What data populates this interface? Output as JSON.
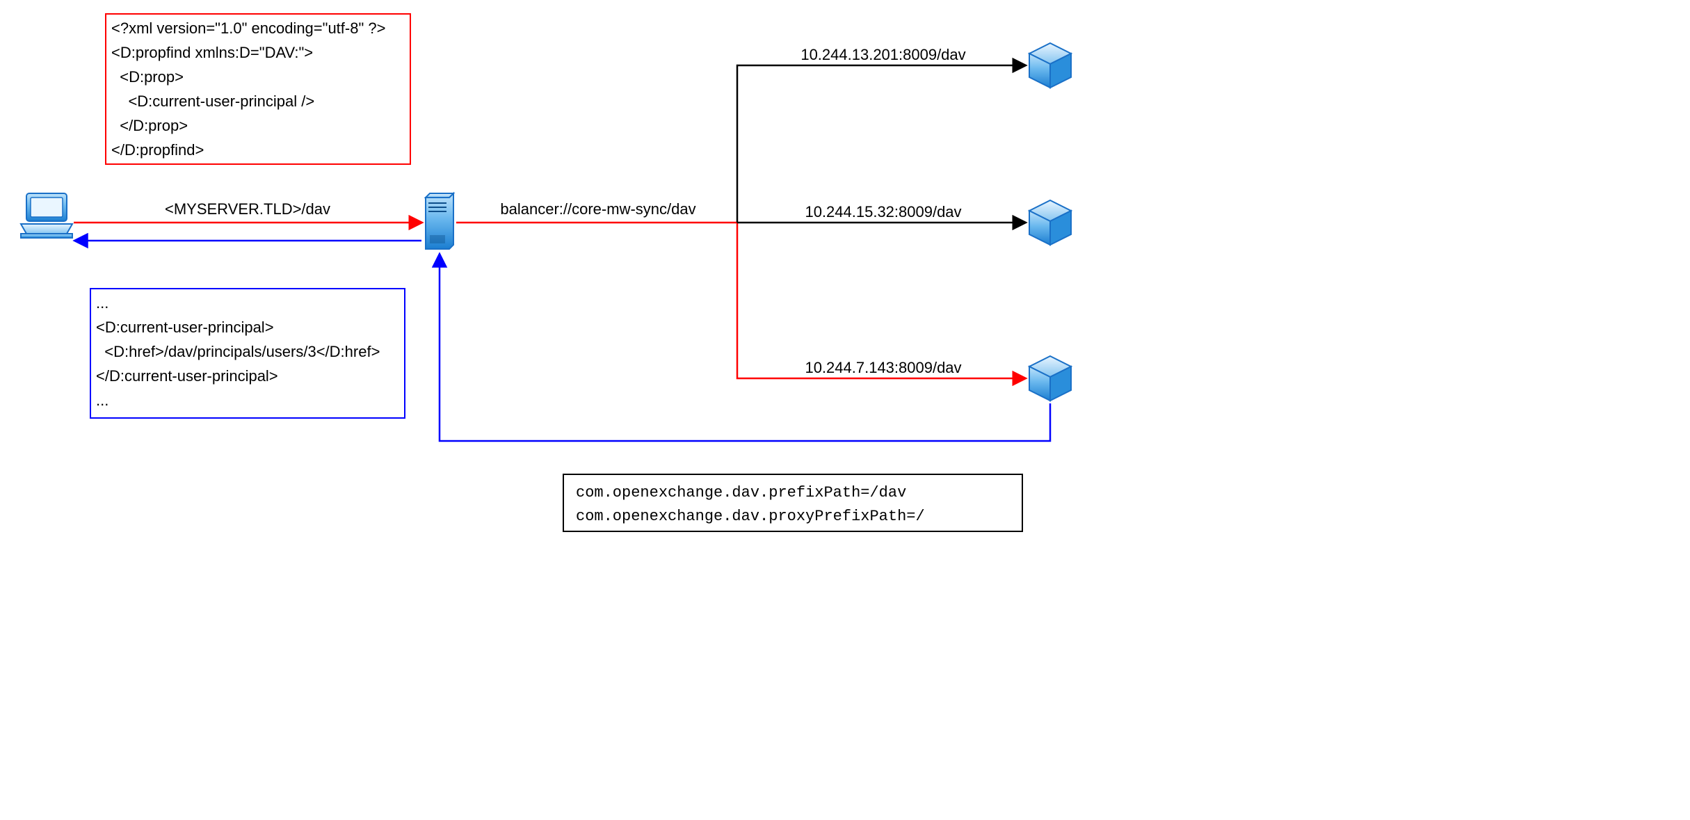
{
  "request_xml": {
    "line1": "<?xml version=\"1.0\" encoding=\"utf-8\" ?>",
    "line2": "<D:propfind xmlns:D=\"DAV:\">",
    "line3": "  <D:prop>",
    "line4": "    <D:current-user-principal />",
    "line5": "  </D:prop>",
    "line6": "</D:propfind>"
  },
  "response_xml": {
    "line1": "...",
    "line2": "<D:current-user-principal>",
    "line3": "  <D:href>/dav/principals/users/3</D:href>",
    "line4": "</D:current-user-principal>",
    "line5": "..."
  },
  "labels": {
    "client_to_lb": "<MYSERVER.TLD>/dav",
    "lb_to_pool": "balancer://core-mw-sync/dav",
    "backend1": "10.244.13.201:8009/dav",
    "backend2": "10.244.15.32:8009/dav",
    "backend3": "10.244.7.143:8009/dav"
  },
  "config_box": {
    "line1": "com.openexchange.dav.prefixPath=/dav",
    "line2": "com.openexchange.dav.proxyPrefixPath=/"
  },
  "colors": {
    "red": "#ff0000",
    "blue": "#0000ff",
    "black": "#000000",
    "node_stroke": "#1a70c7",
    "node_fill_top": "#8ec7f2",
    "node_fill_bottom": "#2a8edb"
  }
}
